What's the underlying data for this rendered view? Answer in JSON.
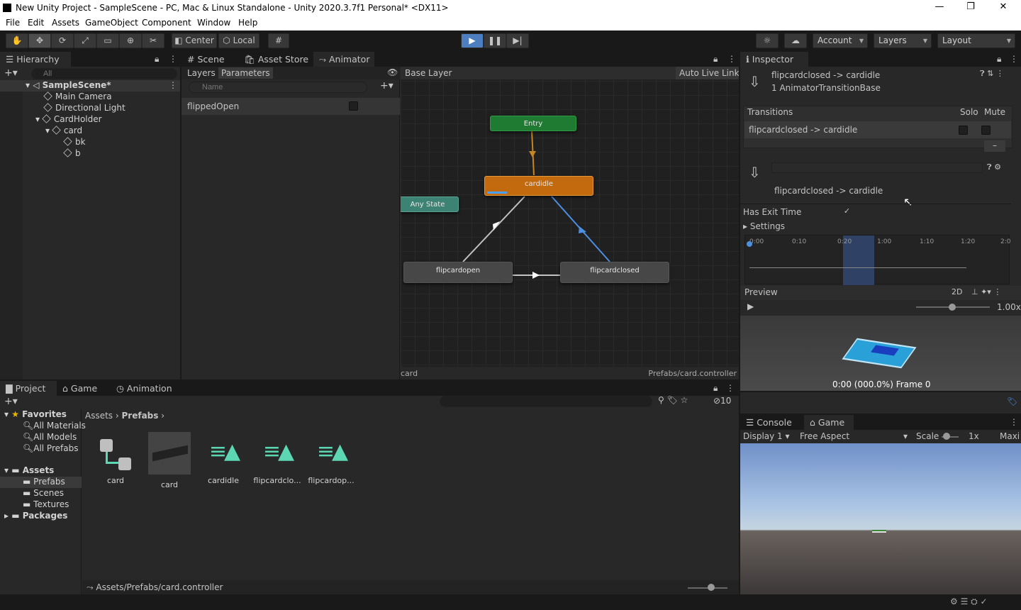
{
  "title": "New Unity Project - SampleScene - PC, Mac & Linux Standalone - Unity 2020.3.7f1 Personal* <DX11>",
  "menu": [
    "File",
    "Edit",
    "Assets",
    "GameObject",
    "Component",
    "Window",
    "Help"
  ],
  "toolbar": {
    "center": "Center",
    "local": "Local",
    "account": "Account",
    "layers": "Layers",
    "layout": "Layout"
  },
  "hierarchy": {
    "tab": "Hierarchy",
    "search_placeholder": "All",
    "scene": "SampleScene*",
    "items": [
      "Main Camera",
      "Directional Light",
      "CardHolder",
      "card",
      "bk",
      "b"
    ]
  },
  "center_tabs": [
    "Scene",
    "Asset Store",
    "Animator"
  ],
  "animator": {
    "left_tabs": [
      "Layers",
      "Parameters"
    ],
    "param_search_placeholder": "Name",
    "parameter": "flippedOpen",
    "breadcrumb": "Base Layer",
    "auto_live_link": "Auto Live Link",
    "states": {
      "entry": "Entry",
      "cardidle": "cardidle",
      "any": "Any State",
      "flipcardopen": "flipcardopen",
      "flipcardclosed": "flipcardclosed"
    },
    "footer_left": "card",
    "footer_right": "Prefabs/card.controller"
  },
  "inspector": {
    "tab": "Inspector",
    "title": "flipcardclosed -> cardidle",
    "subtitle": "1 AnimatorTransitionBase",
    "transitions_header": "Transitions",
    "solo": "Solo",
    "mute": "Mute",
    "transition_item": "flipcardclosed -> cardidle",
    "transition_label": "flipcardclosed -> cardidle",
    "has_exit_time": "Has Exit Time",
    "settings": "Settings",
    "timeline_ticks": [
      "0:00",
      "0:10",
      "0:20",
      "1:00",
      "1:10",
      "1:20",
      "2:0"
    ],
    "preview": "Preview",
    "preview_2d": "2D",
    "speed": "1.00x",
    "frame": "0:00 (000.0%) Frame 0"
  },
  "project": {
    "tabs": [
      "Project",
      "Game",
      "Animation"
    ],
    "favorites": "Favorites",
    "fav_items": [
      "All Materials",
      "All Models",
      "All Prefabs"
    ],
    "assets": "Assets",
    "asset_folders": [
      "Prefabs",
      "Scenes",
      "Textures"
    ],
    "packages": "Packages",
    "breadcrumb": [
      "Assets",
      "Prefabs"
    ],
    "count": "10",
    "files": [
      "card",
      "card",
      "cardidle",
      "flipcardclo...",
      "flipcardop..."
    ],
    "path": "Assets/Prefabs/card.controller"
  },
  "game": {
    "tabs": [
      "Console",
      "Game"
    ],
    "display": "Display 1",
    "aspect": "Free Aspect",
    "scale_label": "Scale",
    "scale": "1x",
    "maxi": "Maxi"
  }
}
